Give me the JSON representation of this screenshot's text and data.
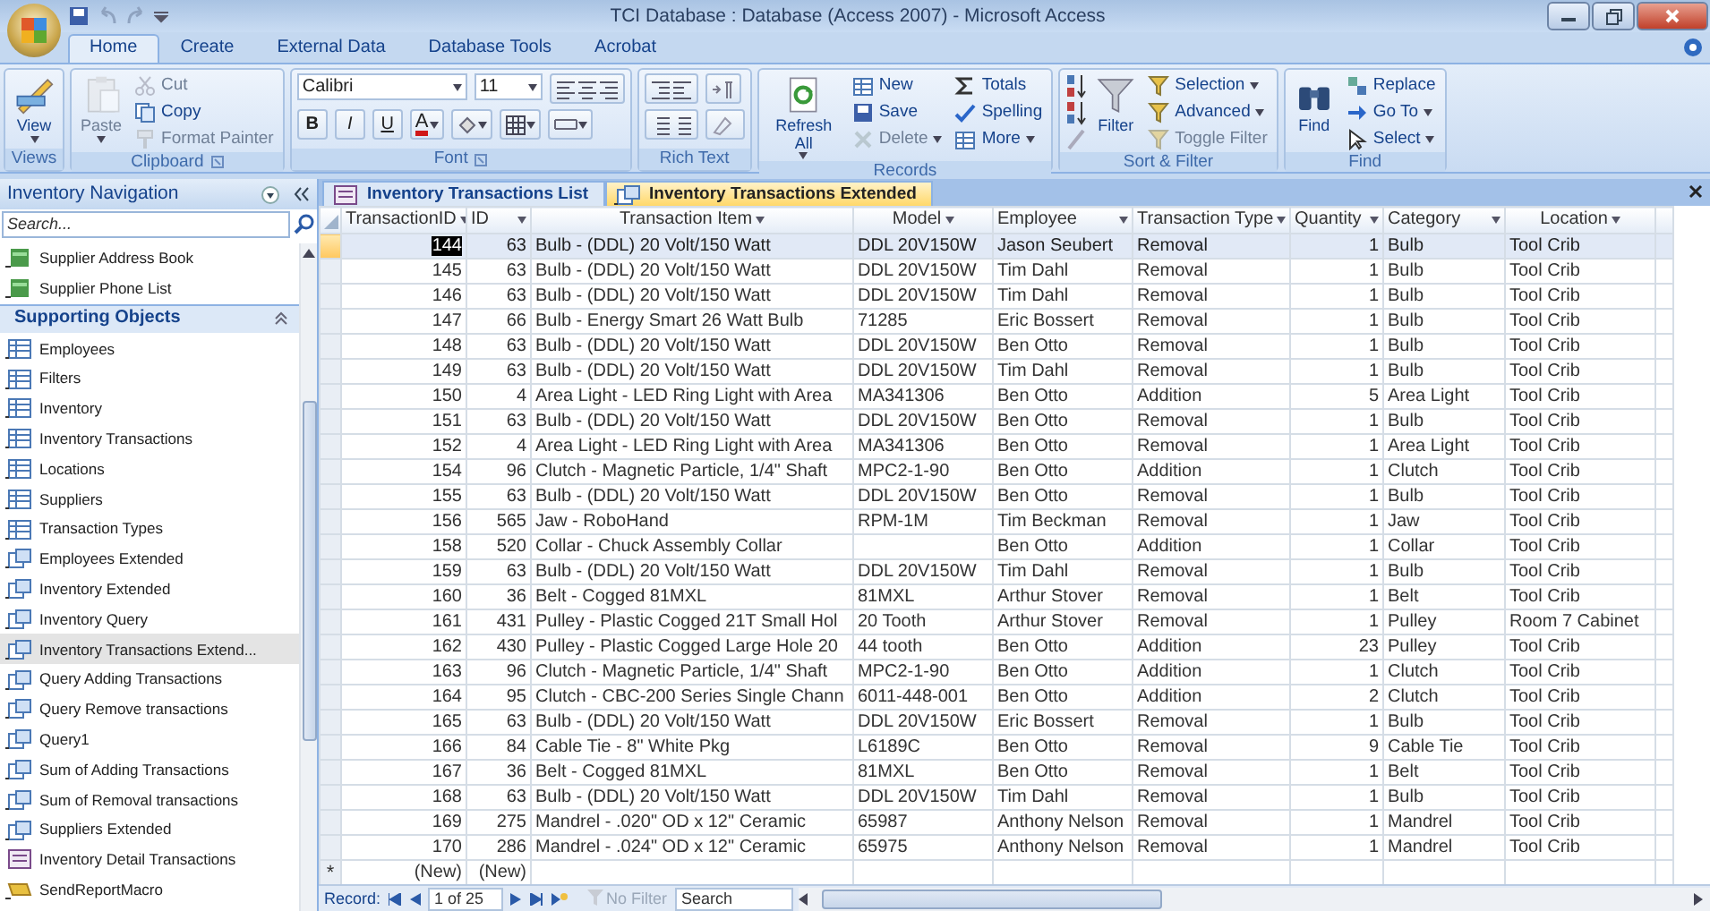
{
  "window": {
    "title": "TCI Database : Database (Access 2007) - Microsoft Access"
  },
  "ribbon_tabs": [
    {
      "label": "Home",
      "selected": true
    },
    {
      "label": "Create",
      "selected": false
    },
    {
      "label": "External Data",
      "selected": false
    },
    {
      "label": "Database Tools",
      "selected": false
    },
    {
      "label": "Acrobat",
      "selected": false
    }
  ],
  "ribbon_groups": [
    {
      "label": "Views",
      "items": [
        {
          "kind": "large",
          "label": "View",
          "disabled": false,
          "dropdown": true
        }
      ]
    },
    {
      "label": "Clipboard",
      "items": [
        {
          "kind": "large",
          "label": "Paste",
          "disabled": true,
          "dropdown": true
        },
        {
          "kind": "small",
          "label": "Cut",
          "disabled": true,
          "dropdown": false
        },
        {
          "kind": "small",
          "label": "Copy",
          "disabled": false,
          "dropdown": false
        },
        {
          "kind": "small",
          "label": "Format Painter",
          "disabled": true,
          "dropdown": false
        }
      ]
    },
    {
      "label": "Font",
      "items": [
        {
          "kind": "combo",
          "label": "Calibri",
          "disabled": false,
          "dropdown": true
        },
        {
          "kind": "combo",
          "label": "11",
          "disabled": false,
          "dropdown": true
        },
        {
          "kind": "format",
          "label": "B",
          "disabled": false,
          "dropdown": false
        },
        {
          "kind": "format",
          "label": "I",
          "disabled": false,
          "dropdown": false
        },
        {
          "kind": "format",
          "label": "U",
          "disabled": false,
          "dropdown": false
        },
        {
          "kind": "format",
          "label": "A",
          "disabled": false,
          "dropdown": true
        }
      ]
    },
    {
      "label": "Rich Text"
    },
    {
      "label": "Records",
      "items": [
        {
          "kind": "large",
          "label": "Refresh All",
          "disabled": false,
          "dropdown": true
        },
        {
          "kind": "small",
          "label": "New",
          "disabled": false,
          "dropdown": false
        },
        {
          "kind": "small",
          "label": "Save",
          "disabled": false,
          "dropdown": false
        },
        {
          "kind": "small",
          "label": "Delete",
          "disabled": true,
          "dropdown": true
        },
        {
          "kind": "small",
          "label": "Totals",
          "disabled": false,
          "dropdown": false
        },
        {
          "kind": "small",
          "label": "Spelling",
          "disabled": false,
          "dropdown": false
        },
        {
          "kind": "small",
          "label": "More",
          "disabled": false,
          "dropdown": true
        }
      ]
    },
    {
      "label": "Sort & Filter",
      "items": [
        {
          "kind": "large",
          "label": "Filter",
          "disabled": false,
          "dropdown": false
        },
        {
          "kind": "small",
          "label": "Selection",
          "disabled": false,
          "dropdown": true
        },
        {
          "kind": "small",
          "label": "Advanced",
          "disabled": false,
          "dropdown": true
        },
        {
          "kind": "small",
          "label": "Toggle Filter",
          "disabled": true,
          "dropdown": false
        }
      ]
    },
    {
      "label": "Find",
      "items": [
        {
          "kind": "large",
          "label": "Find",
          "disabled": false,
          "dropdown": false
        },
        {
          "kind": "small",
          "label": "Replace",
          "disabled": false,
          "dropdown": false
        },
        {
          "kind": "small",
          "label": "Go To",
          "disabled": false,
          "dropdown": true
        },
        {
          "kind": "small",
          "label": "Select",
          "disabled": false,
          "dropdown": true
        }
      ]
    }
  ],
  "navigation": {
    "title": "Inventory Navigation",
    "search": {
      "placeholder": "Search..."
    },
    "items": [
      {
        "kind": "report",
        "label": "Supplier Address Book",
        "selected": false
      },
      {
        "kind": "report",
        "label": "Supplier Phone List",
        "selected": false
      },
      {
        "kind": "group",
        "label": "Supporting Objects",
        "selected": false
      },
      {
        "kind": "table",
        "label": "Employees",
        "selected": false
      },
      {
        "kind": "table",
        "label": "Filters",
        "selected": false
      },
      {
        "kind": "table",
        "label": "Inventory",
        "selected": false
      },
      {
        "kind": "table",
        "label": "Inventory Transactions",
        "selected": false
      },
      {
        "kind": "table",
        "label": "Locations",
        "selected": false
      },
      {
        "kind": "table",
        "label": "Suppliers",
        "selected": false
      },
      {
        "kind": "table",
        "label": "Transaction Types",
        "selected": false
      },
      {
        "kind": "query",
        "label": "Employees Extended",
        "selected": false
      },
      {
        "kind": "query",
        "label": "Inventory Extended",
        "selected": false
      },
      {
        "kind": "query",
        "label": "Inventory Query",
        "selected": false
      },
      {
        "kind": "query",
        "label": "Inventory Transactions Extend...",
        "selected": true
      },
      {
        "kind": "query",
        "label": "Query Adding Transactions",
        "selected": false
      },
      {
        "kind": "query",
        "label": "Query Remove transactions",
        "selected": false
      },
      {
        "kind": "query",
        "label": "Query1",
        "selected": false
      },
      {
        "kind": "query",
        "label": "Sum of Adding Transactions",
        "selected": false
      },
      {
        "kind": "query",
        "label": "Sum of Removal transactions",
        "selected": false
      },
      {
        "kind": "query",
        "label": "Suppliers Extended",
        "selected": false
      },
      {
        "kind": "form",
        "label": "Inventory Detail Transactions",
        "selected": false
      },
      {
        "kind": "macro",
        "label": "SendReportMacro",
        "selected": false
      }
    ]
  },
  "document_tabs": [
    {
      "kind": "form",
      "label": "Inventory Transactions List",
      "selected": false
    },
    {
      "kind": "query",
      "label": "Inventory Transactions Extended",
      "selected": true
    }
  ],
  "table": {
    "columns": [
      "TransactionID",
      "ID",
      "Transaction Item",
      "Model",
      "Employee",
      "Transaction Type",
      "Quantity",
      "Category",
      "Location"
    ],
    "rows": [
      {
        "selected": true,
        "cells": [
          "144",
          "63",
          "Bulb - (DDL) 20 Volt/150 Watt",
          "DDL 20V150W",
          "Jason Seubert",
          "Removal",
          "1",
          "Bulb",
          "Tool Crib"
        ]
      },
      {
        "selected": false,
        "cells": [
          "145",
          "63",
          "Bulb - (DDL) 20 Volt/150 Watt",
          "DDL 20V150W",
          "Tim Dahl",
          "Removal",
          "1",
          "Bulb",
          "Tool Crib"
        ]
      },
      {
        "selected": false,
        "cells": [
          "146",
          "63",
          "Bulb - (DDL) 20 Volt/150 Watt",
          "DDL 20V150W",
          "Tim Dahl",
          "Removal",
          "1",
          "Bulb",
          "Tool Crib"
        ]
      },
      {
        "selected": false,
        "cells": [
          "147",
          "66",
          "Bulb - Energy Smart 26 Watt Bulb",
          "71285",
          "Eric Bossert",
          "Removal",
          "1",
          "Bulb",
          "Tool Crib"
        ]
      },
      {
        "selected": false,
        "cells": [
          "148",
          "63",
          "Bulb - (DDL) 20 Volt/150 Watt",
          "DDL 20V150W",
          "Ben Otto",
          "Removal",
          "1",
          "Bulb",
          "Tool Crib"
        ]
      },
      {
        "selected": false,
        "cells": [
          "149",
          "63",
          "Bulb - (DDL) 20 Volt/150 Watt",
          "DDL 20V150W",
          "Tim Dahl",
          "Removal",
          "1",
          "Bulb",
          "Tool Crib"
        ]
      },
      {
        "selected": false,
        "cells": [
          "150",
          "4",
          "Area Light - LED Ring Light with Area",
          "MA341306",
          "Ben Otto",
          "Addition",
          "5",
          "Area Light",
          "Tool Crib"
        ]
      },
      {
        "selected": false,
        "cells": [
          "151",
          "63",
          "Bulb - (DDL) 20 Volt/150 Watt",
          "DDL 20V150W",
          "Ben Otto",
          "Removal",
          "1",
          "Bulb",
          "Tool Crib"
        ]
      },
      {
        "selected": false,
        "cells": [
          "152",
          "4",
          "Area Light - LED Ring Light with Area",
          "MA341306",
          "Ben Otto",
          "Removal",
          "1",
          "Area Light",
          "Tool Crib"
        ]
      },
      {
        "selected": false,
        "cells": [
          "154",
          "96",
          "Clutch - Magnetic Particle, 1/4\" Shaft",
          "MPC2-1-90",
          "Ben Otto",
          "Addition",
          "1",
          "Clutch",
          "Tool Crib"
        ]
      },
      {
        "selected": false,
        "cells": [
          "155",
          "63",
          "Bulb - (DDL) 20 Volt/150 Watt",
          "DDL 20V150W",
          "Ben Otto",
          "Removal",
          "1",
          "Bulb",
          "Tool Crib"
        ]
      },
      {
        "selected": false,
        "cells": [
          "156",
          "565",
          "Jaw - RoboHand",
          "RPM-1M",
          "Tim Beckman",
          "Removal",
          "1",
          "Jaw",
          "Tool Crib"
        ]
      },
      {
        "selected": false,
        "cells": [
          "158",
          "520",
          "Collar - Chuck Assembly Collar",
          null,
          "Ben Otto",
          "Addition",
          "1",
          "Collar",
          "Tool Crib"
        ]
      },
      {
        "selected": false,
        "cells": [
          "159",
          "63",
          "Bulb - (DDL) 20 Volt/150 Watt",
          "DDL 20V150W",
          "Tim Dahl",
          "Removal",
          "1",
          "Bulb",
          "Tool Crib"
        ]
      },
      {
        "selected": false,
        "cells": [
          "160",
          "36",
          "Belt - Cogged 81MXL",
          "81MXL",
          "Arthur Stover",
          "Removal",
          "1",
          "Belt",
          "Tool Crib"
        ]
      },
      {
        "selected": false,
        "cells": [
          "161",
          "431",
          "Pulley - Plastic Cogged 21T Small Hol",
          "20 Tooth",
          "Arthur Stover",
          "Removal",
          "1",
          "Pulley",
          "Room 7 Cabinet"
        ]
      },
      {
        "selected": false,
        "cells": [
          "162",
          "430",
          "Pulley - Plastic Cogged Large Hole 20",
          "44 tooth",
          "Ben Otto",
          "Addition",
          "23",
          "Pulley",
          "Tool Crib"
        ]
      },
      {
        "selected": false,
        "cells": [
          "163",
          "96",
          "Clutch - Magnetic Particle, 1/4\" Shaft",
          "MPC2-1-90",
          "Ben Otto",
          "Addition",
          "1",
          "Clutch",
          "Tool Crib"
        ]
      },
      {
        "selected": false,
        "cells": [
          "164",
          "95",
          "Clutch - CBC-200 Series Single Chann",
          "6011-448-001",
          "Ben Otto",
          "Addition",
          "2",
          "Clutch",
          "Tool Crib"
        ]
      },
      {
        "selected": false,
        "cells": [
          "165",
          "63",
          "Bulb - (DDL) 20 Volt/150 Watt",
          "DDL 20V150W",
          "Eric Bossert",
          "Removal",
          "1",
          "Bulb",
          "Tool Crib"
        ]
      },
      {
        "selected": false,
        "cells": [
          "166",
          "84",
          "Cable Tie - 8\"  White Pkg",
          "L6189C",
          "Ben Otto",
          "Removal",
          "9",
          "Cable Tie",
          "Tool Crib"
        ]
      },
      {
        "selected": false,
        "cells": [
          "167",
          "36",
          "Belt - Cogged 81MXL",
          "81MXL",
          "Ben Otto",
          "Removal",
          "1",
          "Belt",
          "Tool Crib"
        ]
      },
      {
        "selected": false,
        "cells": [
          "168",
          "63",
          "Bulb - (DDL) 20 Volt/150 Watt",
          "DDL 20V150W",
          "Tim Dahl",
          "Removal",
          "1",
          "Bulb",
          "Tool Crib"
        ]
      },
      {
        "selected": false,
        "cells": [
          "169",
          "275",
          "Mandrel - .020\" OD x 12\" Ceramic",
          "65987",
          "Anthony Nelson",
          "Removal",
          "1",
          "Mandrel",
          "Tool Crib"
        ]
      },
      {
        "selected": false,
        "cells": [
          "170",
          "286",
          "Mandrel - .024\" OD x 12\" Ceramic",
          "65975",
          "Anthony Nelson",
          "Removal",
          "1",
          "Mandrel",
          "Tool Crib"
        ]
      }
    ],
    "new_row": {
      "marker": "*",
      "cells": [
        "(New)",
        "(New)"
      ]
    }
  },
  "record_navigator": {
    "label": "Record:",
    "position": "1 of 25",
    "filter": "No Filter",
    "search": "Search"
  }
}
